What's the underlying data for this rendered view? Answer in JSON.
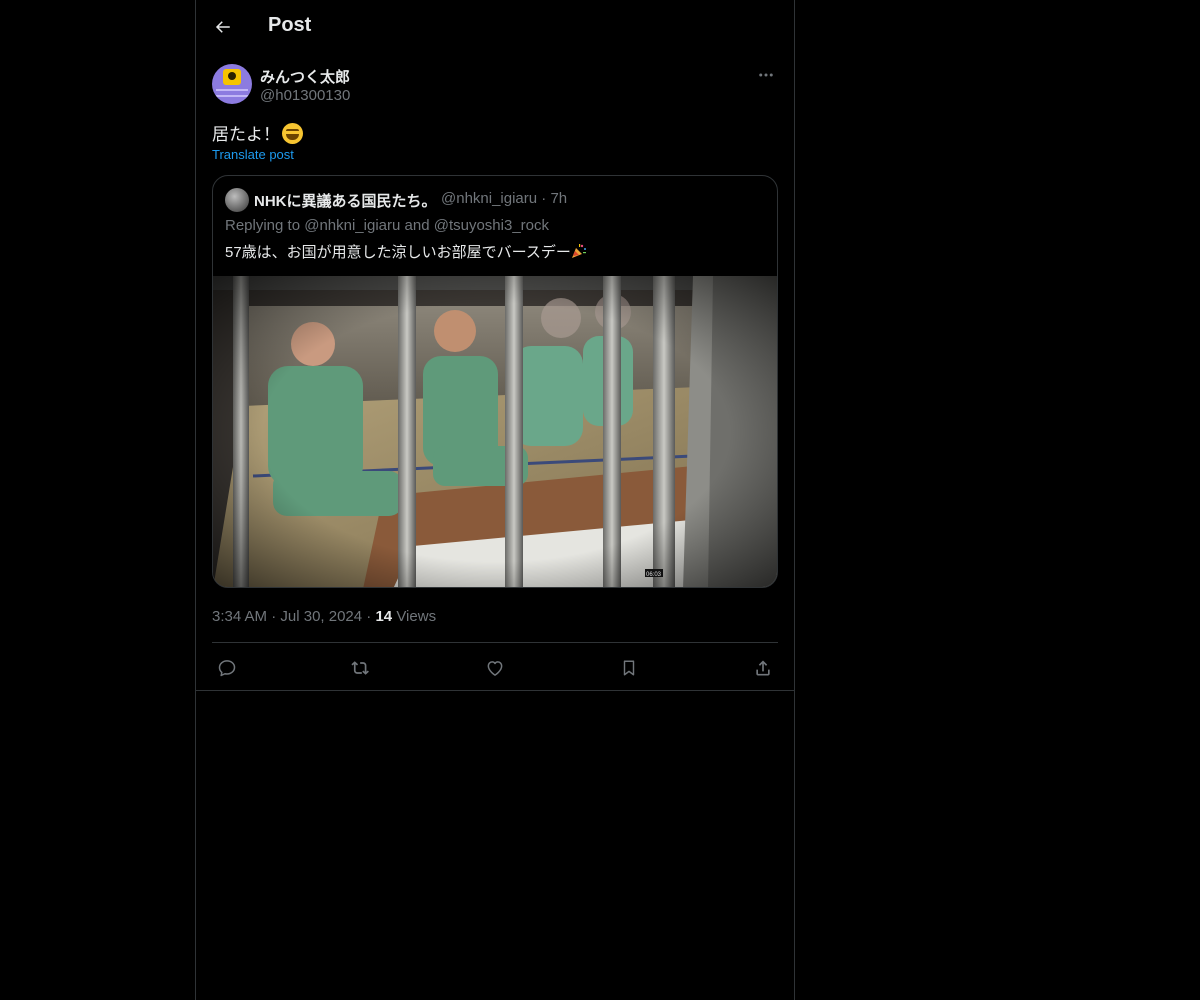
{
  "header": {
    "title": "Post"
  },
  "post": {
    "display_name": "みんつく太郎",
    "handle": "@h01300130",
    "text": "居たよ！",
    "translate_label": "Translate post",
    "timestamp": "3:34 AM",
    "date": "Jul 30, 2024",
    "views_count": "14",
    "views_label": "Views",
    "separator": "·"
  },
  "quote": {
    "display_name": "NHKに異議ある国民たち。",
    "handle": "@nhkni_igiaru",
    "time": "7h",
    "replying_prefix": "Replying to",
    "reply_mention_1": "@nhkni_igiaru",
    "reply_and": "and",
    "reply_mention_2": "@tsuyoshi3_rock",
    "text": "57歳は、お国が用意した涼しいお部屋でバースデー",
    "media_timestamp": "06:03"
  },
  "icons": {
    "back": "arrow-left-icon",
    "more": "more-horizontal-icon",
    "reply": "reply-icon",
    "repost": "repost-icon",
    "like": "heart-icon",
    "bookmark": "bookmark-icon",
    "share": "share-icon"
  },
  "colors": {
    "background": "#000000",
    "text_primary": "#e7e9ea",
    "text_secondary": "#71767b",
    "accent": "#1d9bf0",
    "border": "#2f3336"
  }
}
